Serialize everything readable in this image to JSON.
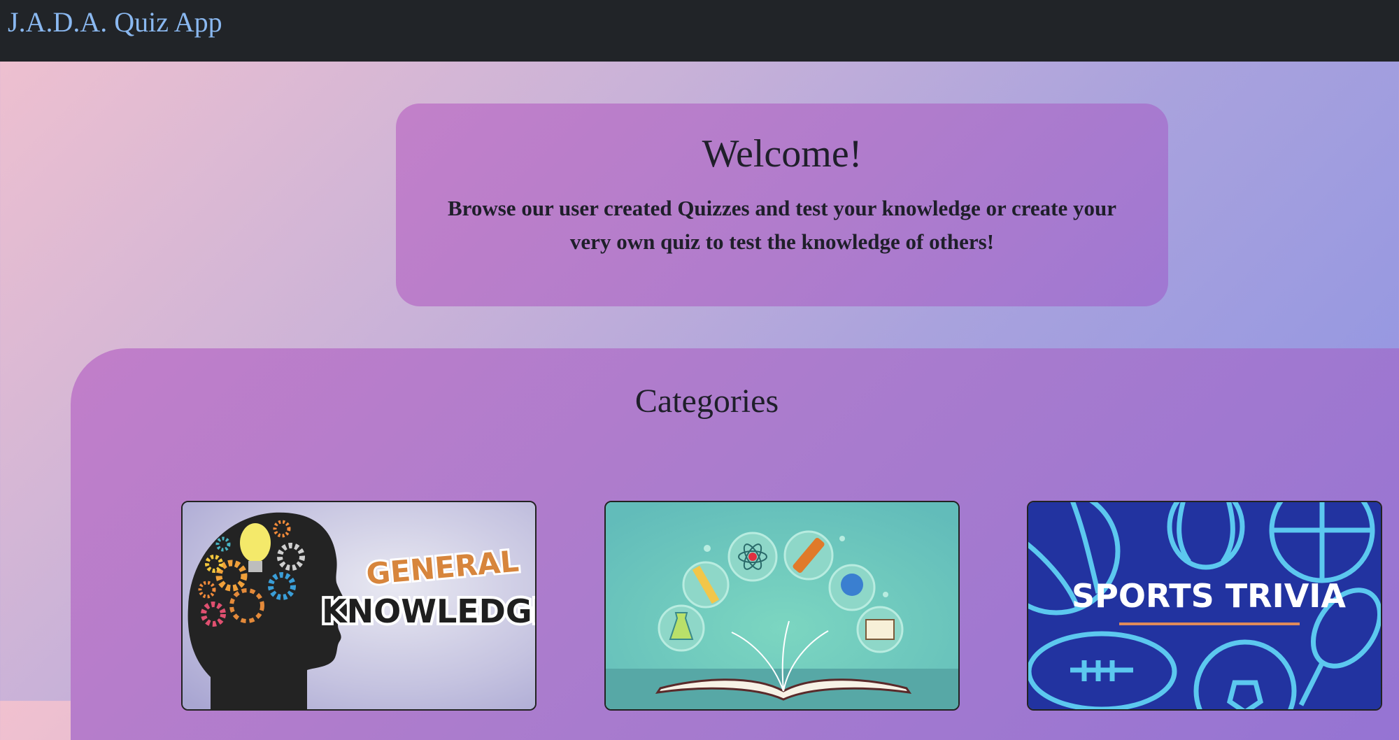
{
  "navbar": {
    "brand": "J.A.D.A. Quiz App"
  },
  "welcome": {
    "title": "Welcome!",
    "text": "Browse our user created Quizzes and test your knowledge or create your very own quiz to test the knowledge of others!"
  },
  "categories": {
    "title": "Categories",
    "cards": [
      {
        "line1": "GENERAL",
        "line2": "KNOWLEDGE"
      },
      {
        "label": ""
      },
      {
        "label": "SPORTS TRIVIA"
      }
    ]
  },
  "colors": {
    "navbar_bg": "#212428",
    "brand": "#8ab8f0",
    "panel": "#b07ccc",
    "sports_bg": "#2233a0",
    "sports_lines": "#5cc8ef",
    "education_bg": "#6cc4bd"
  }
}
